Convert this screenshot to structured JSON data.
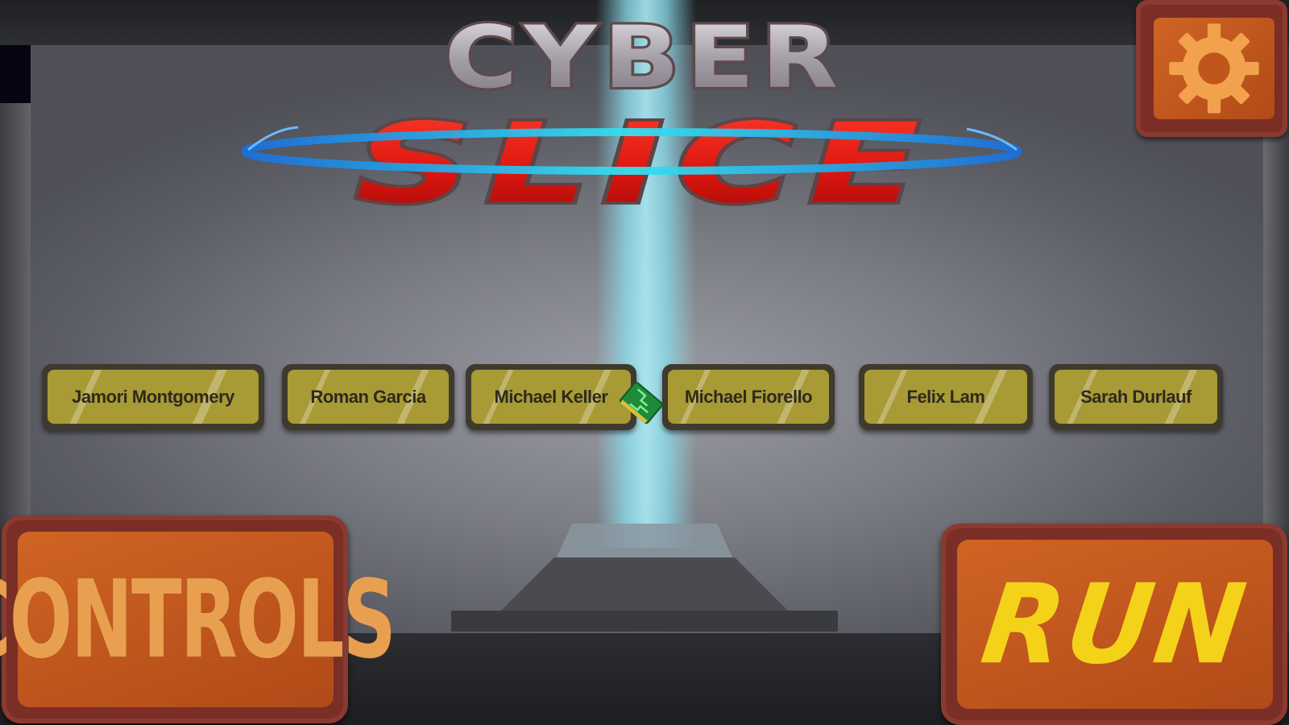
{
  "game": {
    "title_line1": "CYBER",
    "title_line2": "SLICE"
  },
  "colors": {
    "button_gold": "#a89a35",
    "button_orange": "#c85a1e",
    "button_frame": "#7a2e26",
    "run_text": "#f4d21a",
    "controls_text": "#e8a050",
    "title_red": "#e01c14",
    "title_silver": "#b0aab2",
    "beam_cyan": "#8fdcea"
  },
  "settings": {
    "icon": "gear-icon"
  },
  "credits": {
    "names": [
      "Jamori Montgomery",
      "Roman Garcia",
      "Michael Keller",
      "Michael Fiorello",
      "Felix Lam",
      "Sarah Durlauf"
    ]
  },
  "chip": {
    "icon": "circuit-chip-icon"
  },
  "buttons": {
    "controls_label": "CONTROLS",
    "run_label": "RUN"
  }
}
